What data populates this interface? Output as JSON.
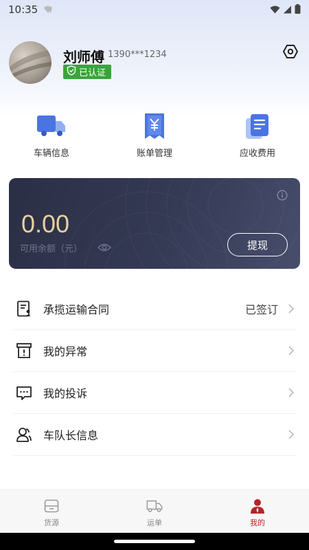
{
  "status_bar": {
    "time": "10:35"
  },
  "profile": {
    "name": "刘师傅",
    "phone": "1390***1234",
    "verified_label": "已认证"
  },
  "quick_menu": [
    {
      "label": "车辆信息",
      "icon": "truck-icon"
    },
    {
      "label": "账单管理",
      "icon": "bill-icon"
    },
    {
      "label": "应收费用",
      "icon": "receivable-document-icon"
    }
  ],
  "wallet": {
    "amount": "0.00",
    "balance_label": "可用余额（元）",
    "withdraw_label": "提现"
  },
  "menu": [
    {
      "label": "承揽运输合同",
      "status": "已签订",
      "icon": "contract-icon"
    },
    {
      "label": "我的异常",
      "status": "",
      "icon": "exception-box-icon"
    },
    {
      "label": "我的投诉",
      "status": "",
      "icon": "complaint-message-icon"
    },
    {
      "label": "车队长信息",
      "status": "",
      "icon": "team-leader-icon"
    }
  ],
  "tabs": [
    {
      "label": "货源",
      "active": false,
      "icon": "cargo-icon"
    },
    {
      "label": "运单",
      "active": false,
      "icon": "waybill-truck-icon"
    },
    {
      "label": "我的",
      "active": true,
      "icon": "profile-icon"
    }
  ],
  "colors": {
    "accent_red": "#b3262c",
    "verified_green": "#3aa43b",
    "card_dark": "#2b2f45",
    "amount_gold": "#e7cf9f",
    "icon_blue": "#4b74e3"
  }
}
